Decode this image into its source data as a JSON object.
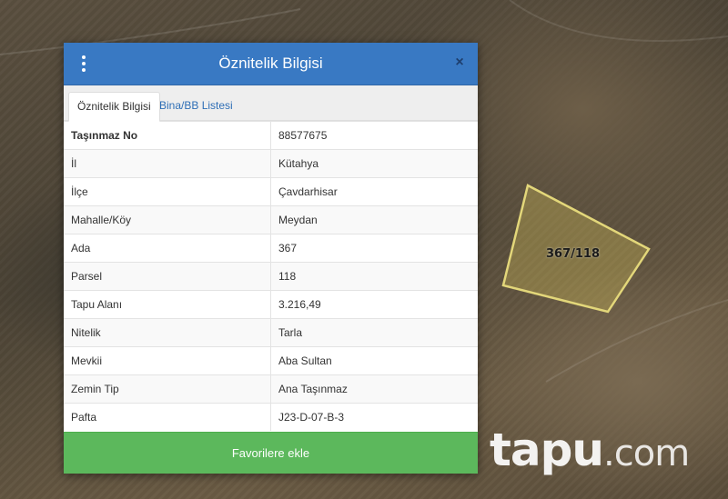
{
  "modal": {
    "title": "Öznitelik Bilgisi",
    "close_label": "×"
  },
  "tabs": [
    {
      "label": "Öznitelik Bilgisi",
      "active": true
    },
    {
      "label": "Bina/BB Listesi",
      "active": false
    }
  ],
  "attributes": [
    {
      "key": "Taşınmaz No",
      "value": "88577675"
    },
    {
      "key": "İl",
      "value": "Kütahya"
    },
    {
      "key": "İlçe",
      "value": "Çavdarhisar"
    },
    {
      "key": "Mahalle/Köy",
      "value": "Meydan"
    },
    {
      "key": "Ada",
      "value": "367"
    },
    {
      "key": "Parsel",
      "value": "118"
    },
    {
      "key": "Tapu Alanı",
      "value": "3.216,49"
    },
    {
      "key": "Nitelik",
      "value": "Tarla"
    },
    {
      "key": "Mevkii",
      "value": "Aba Sultan"
    },
    {
      "key": "Zemin Tip",
      "value": "Ana Taşınmaz"
    },
    {
      "key": "Pafta",
      "value": "J23-D-07-B-3"
    }
  ],
  "favorite_button": {
    "label": "Favorilere ekle"
  },
  "map": {
    "parcel_label": "367/118",
    "parcel_outline_color": "#e3d77a"
  },
  "watermark": {
    "brand": "tapu",
    "suffix": ".com"
  },
  "colors": {
    "header": "#3979c3",
    "button": "#5cb85c",
    "tab_link": "#2f6fb6"
  }
}
